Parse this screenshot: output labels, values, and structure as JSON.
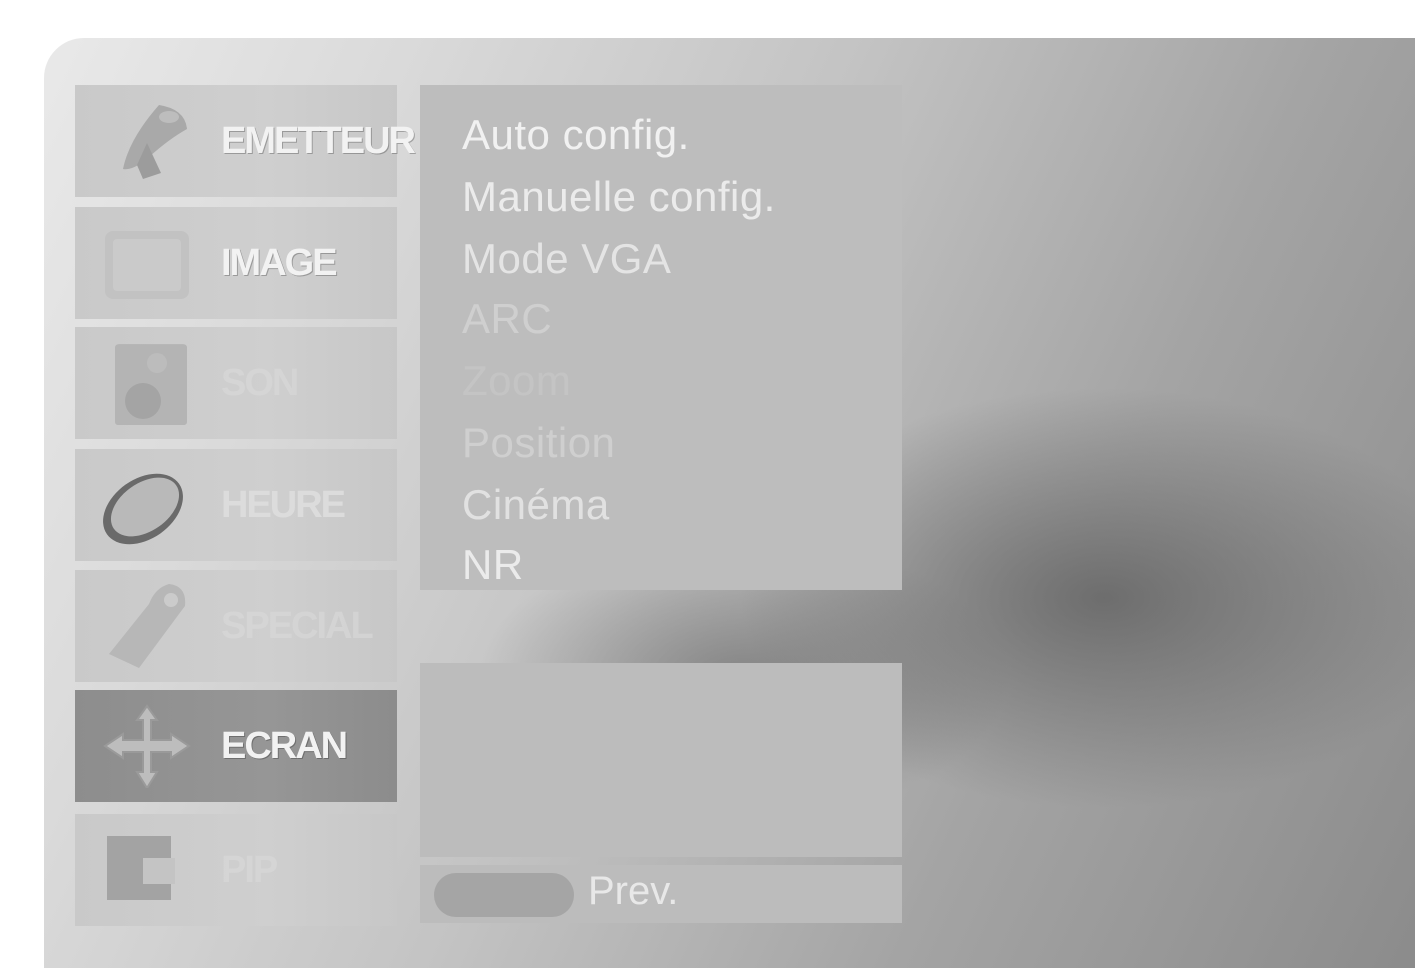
{
  "categories": [
    {
      "label": "EMETTEUR",
      "icon": "satellite-dish-icon",
      "selected": false
    },
    {
      "label": "IMAGE",
      "icon": "picture-icon",
      "selected": false
    },
    {
      "label": "SON",
      "icon": "speaker-icon",
      "selected": false
    },
    {
      "label": "HEURE",
      "icon": "clock-icon",
      "selected": false
    },
    {
      "label": "SPECIAL",
      "icon": "tag-icon",
      "selected": false
    },
    {
      "label": "ECRAN",
      "icon": "move-arrows-icon",
      "selected": true
    },
    {
      "label": "PIP",
      "icon": "pip-icon",
      "selected": false
    }
  ],
  "menu": {
    "items": [
      "Auto config.",
      "Manuelle config.",
      "Mode VGA",
      "ARC",
      "Zoom",
      "Position",
      "Cinéma",
      "NR"
    ]
  },
  "footer": {
    "prev_label": "Prev."
  },
  "colors": {
    "selected_category": "#8d8d8d",
    "panel": "#bdbdbd",
    "text": "#f1f1f1"
  }
}
